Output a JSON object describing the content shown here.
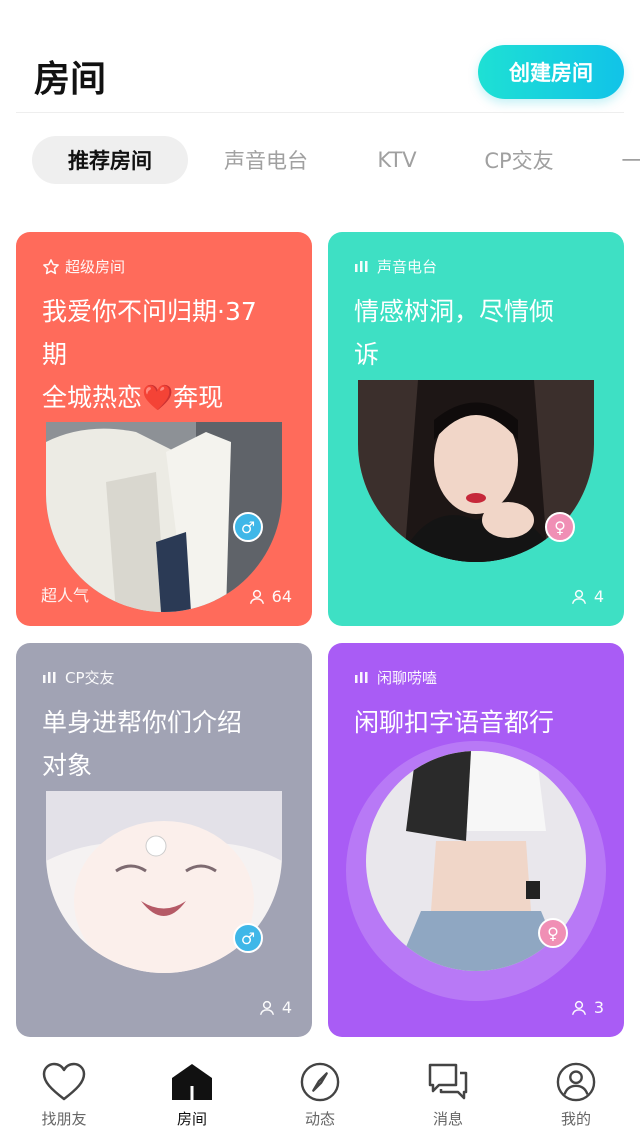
{
  "header": {
    "title": "房间",
    "create_button": "创建房间"
  },
  "tabs": [
    {
      "label": "推荐房间",
      "active": true
    },
    {
      "label": "声音电台",
      "active": false
    },
    {
      "label": "KTV",
      "active": false
    },
    {
      "label": "CP交友",
      "active": false
    },
    {
      "label": "一",
      "active": false
    }
  ],
  "cards": [
    {
      "tag_icon": "star-icon",
      "tag": "超级房间",
      "title": "我爱你不问归期·37\n期\n全城热恋❤️奔现",
      "gender": "male",
      "gender_symbol": "♂",
      "badge": "超人气",
      "count": "64",
      "color": "#ff6b5b"
    },
    {
      "tag_icon": "audio-bars-icon",
      "tag": "声音电台",
      "title": "情感树洞，尽情倾\n诉",
      "gender": "female",
      "gender_symbol": "♀",
      "badge": "",
      "count": "4",
      "color": "#3ee0c4"
    },
    {
      "tag_icon": "audio-bars-icon",
      "tag": "CP交友",
      "title": "单身进帮你们介绍\n对象",
      "gender": "male",
      "gender_symbol": "♂",
      "badge": "",
      "count": "4",
      "color": "#a1a3b4"
    },
    {
      "tag_icon": "audio-bars-icon",
      "tag": "闲聊唠嗑",
      "title": "闲聊扣字语音都行",
      "gender": "female",
      "gender_symbol": "♀",
      "badge": "",
      "count": "3",
      "color": "#a95cf5"
    }
  ],
  "tabbar": [
    {
      "label": "找朋友",
      "icon": "heart-icon",
      "active": false
    },
    {
      "label": "房间",
      "icon": "house-icon",
      "active": true
    },
    {
      "label": "动态",
      "icon": "compass-icon",
      "active": false
    },
    {
      "label": "消息",
      "icon": "chat-bubbles-icon",
      "active": false
    },
    {
      "label": "我的",
      "icon": "user-icon",
      "active": false
    }
  ]
}
